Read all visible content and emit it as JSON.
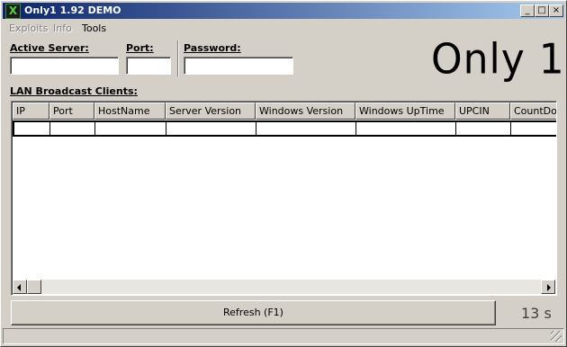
{
  "window": {
    "title": "Only1 1.92 DEMO",
    "icon": "x-app-icon",
    "controls": {
      "minimize": "_",
      "maximize": "□",
      "close": "×"
    }
  },
  "menu": {
    "items": [
      {
        "label": "Exploits",
        "enabled": false
      },
      {
        "label": "Info",
        "enabled": false
      },
      {
        "label": "Tools",
        "enabled": true
      }
    ]
  },
  "fields": {
    "active_server": {
      "label": "Active Server:",
      "value": ""
    },
    "port": {
      "label": "Port:",
      "value": ""
    },
    "password": {
      "label": "Password:",
      "value": ""
    }
  },
  "logo": {
    "text": "Only 1"
  },
  "clients": {
    "label": "LAN Broadcast Clients:",
    "columns": [
      "IP",
      "Port",
      "HostName",
      "Server Version",
      "Windows Version",
      "Windows UpTime",
      "UPCIN",
      "CountDow"
    ],
    "rows": [
      [
        "",
        "",
        "",
        "",
        "",
        "",
        "",
        ""
      ]
    ]
  },
  "refresh_button": {
    "label": "Refresh (F1)"
  },
  "timer": {
    "text": "13 s"
  }
}
